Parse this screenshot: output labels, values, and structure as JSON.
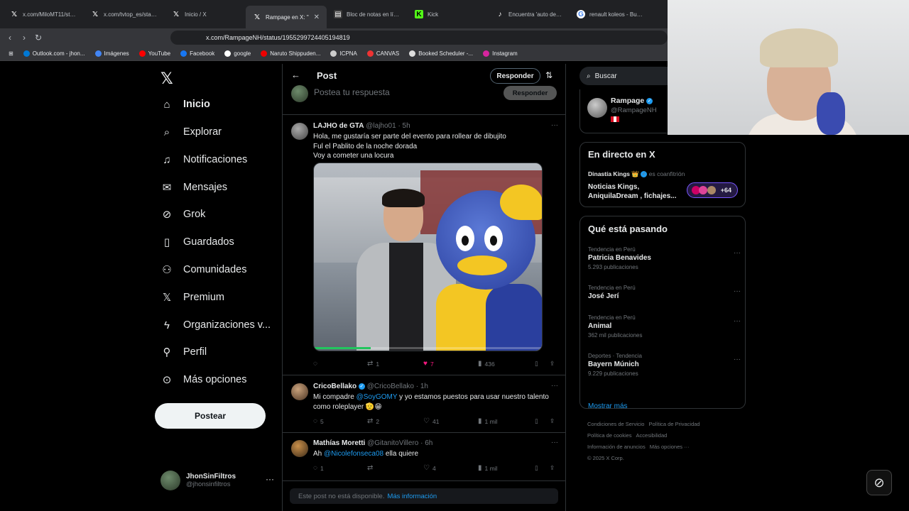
{
  "browser": {
    "tabs": [
      {
        "label": "x.com/MiloMT11/stat...",
        "icon": "x-logo"
      },
      {
        "label": "x.com/tvtop_es/statu...",
        "icon": "x-logo"
      },
      {
        "label": "Inicio / X",
        "icon": "x-logo"
      },
      {
        "label": "Rampage en X: \"",
        "icon": "x-logo",
        "active": true
      },
      {
        "label": "Bloc de notas en línea",
        "icon": "doc-icon"
      },
      {
        "label": "Kick",
        "icon": "kick-logo"
      },
      {
        "label": "Encuentra 'auto de se...",
        "icon": "tiktok-logo"
      },
      {
        "label": "renault koleos - Busca...",
        "icon": "google-logo"
      }
    ],
    "url": "x.com/RampageNH/status/1955299724405194819",
    "bookmarks": [
      "Outlook.com - jhon...",
      "Imágenes",
      "YouTube",
      "Facebook",
      "google",
      "Naruto Shippuden...",
      "ICPNA",
      "CANVAS",
      "Booked Scheduler -...",
      "Instagram"
    ]
  },
  "nav": {
    "items": [
      "Inicio",
      "Explorar",
      "Notificaciones",
      "Mensajes",
      "Grok",
      "Guardados",
      "Comunidades",
      "Premium",
      "Organizaciones v...",
      "Perfil",
      "Más opciones"
    ],
    "post_label": "Postear",
    "account_name": "JhonSinFiltros",
    "account_handle": "@jhonsinfiltros"
  },
  "header": {
    "title": "Post",
    "reply_label": "Responder"
  },
  "compose": {
    "placeholder": "Postea tu respuesta",
    "reply_label": "Responder"
  },
  "tweets": [
    {
      "name": "LAJHO de GTA",
      "handle": "@lajho01 · 5h",
      "lines": [
        "Hola, me gustaría ser parte del evento para rollear de dibujito",
        "Ful el Pablito de la noche dorada",
        "Voy a cometer una locura"
      ],
      "replies": "",
      "retweets": "1",
      "likes": "7",
      "views": "436",
      "video_progress": 0.25
    },
    {
      "name": "CricoBellako",
      "handle": "@CricoBellako · 1h",
      "text_pre": "Mi compadre ",
      "mention": "@SoyGOMY",
      "text_post": " y yo estamos puestos para usar nuestro talento como roleplayer 🫡😁",
      "replies": "5",
      "retweets": "2",
      "likes": "41",
      "views": "1 mil"
    },
    {
      "name": "Mathías Moretti",
      "handle": "@GitanitoVillero · 6h",
      "text_pre": "Ah ",
      "mention": "@Nicolefonseca08",
      "text_post": " ella quiere",
      "replies": "1",
      "retweets": "",
      "likes": "4",
      "views": "1 mil"
    }
  ],
  "unavailable": {
    "text": "Este post no está disponible.",
    "link": "Más información"
  },
  "right": {
    "search_placeholder": "Buscar",
    "profile_name": "Rampage",
    "profile_handle": "@RampageNH",
    "live_title": "En directo en X",
    "live_host": "Dinastía Kings 👑",
    "live_cohost": "es coanfitrión",
    "live_desc": "Noticias Kings, AniquilaDream , fichajes...",
    "live_count": "+64",
    "trends_title": "Qué está pasando",
    "trends": [
      {
        "context": "Tendencia en Perú",
        "title": "Patricia Benavides",
        "count": "5.293 publicaciones"
      },
      {
        "context": "Tendencia en Perú",
        "title": "José Jerí",
        "count": ""
      },
      {
        "context": "Tendencia en Perú",
        "title": "Animal",
        "count": "362 mil publicaciones"
      },
      {
        "context": "Deportes · Tendencia",
        "title": "Bayern Múnich",
        "count": "9.229 publicaciones"
      }
    ],
    "show_more": "Mostrar más",
    "footer": [
      "Condiciones de Servicio",
      "Política de Privacidad",
      "Política de cookies",
      "Accesibilidad",
      "Información de anuncios",
      "Más opciones ···",
      "© 2025 X Corp."
    ]
  }
}
